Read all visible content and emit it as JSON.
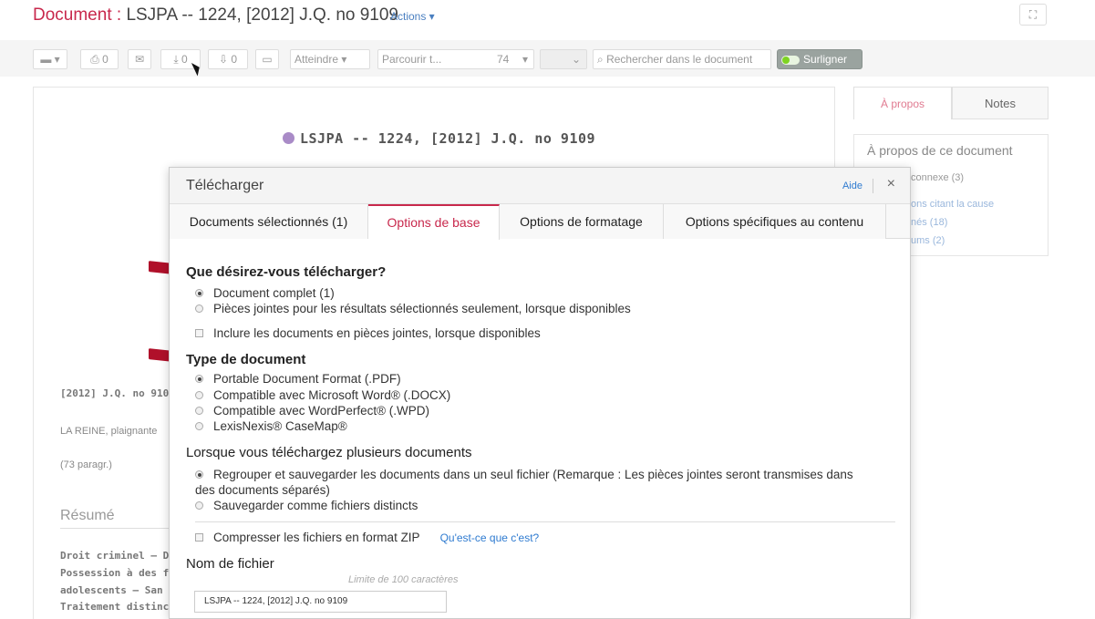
{
  "header": {
    "doc_label": "Document :",
    "doc_name": "LSJPA -- 1224, [2012] J.Q. no 9109",
    "actions_label": "Actions ▾",
    "expand_icon": "expand-icon"
  },
  "toolbar": {
    "print_count": "0",
    "download_count": "0",
    "save_count": "0",
    "goto_label": "Atteindre",
    "browse_label": "Parcourir t...",
    "browse_count": "74",
    "search_placeholder": "Rechercher dans le document",
    "highlight_label": "Surligner"
  },
  "document": {
    "heading": "LSJPA -- 1224, [2012] J.Q. no 9109",
    "citation": "[2012] J.Q. no 910",
    "parties": "LA REINE, plaignante",
    "paragraphs": "(73 paragr.)",
    "resume_title": "Résumé",
    "summary_lines": [
      "Droit criminel — Dé",
      "Possession à des fi",
      "adolescents — San",
      "Traitement distinct"
    ]
  },
  "sidebar": {
    "tab_about": "À propos",
    "tab_notes": "Notes",
    "about_title": "À propos de ce document",
    "lines": [
      "connexe (3)",
      "ons citant la cause",
      "nés (18)",
      "ums (2)"
    ]
  },
  "modal": {
    "title": "Télécharger",
    "help_label": "Aide",
    "close_label": "×",
    "tabs": [
      "Documents sélectionnés (1)",
      "Options de base",
      "Options de formatage",
      "Options spécifiques au contenu"
    ],
    "what_title": "Que désirez-vous télécharger?",
    "what_options": [
      "Document complet (1)",
      "Pièces jointes pour les résultats sélectionnés seulement, lorsque disponibles"
    ],
    "include_attachments": "Inclure les documents en pièces jointes, lorsque disponibles",
    "type_title": "Type de document",
    "type_options": [
      "Portable Document Format (.PDF)",
      "Compatible avec Microsoft Word® (.DOCX)",
      "Compatible avec WordPerfect® (.WPD)",
      "LexisNexis® CaseMap®"
    ],
    "multi_title": "Lorsque vous téléchargez plusieurs documents",
    "multi_options": [
      "Regrouper et sauvegarder les documents dans un seul fichier (Remarque : Les pièces jointes seront transmises dans",
      "des documents séparés)",
      "Sauvegarder comme fichiers distincts"
    ],
    "zip_label": "Compresser les fichiers en format ZIP",
    "zip_help": "Qu'est-ce que c'est?",
    "filename_title": "Nom de fichier",
    "filename_limit": "Limite de 100 caractères",
    "filename_value": "LSJPA -- 1224, [2012] J.Q. no 9109"
  },
  "colors": {
    "accent": "#c8284c",
    "link": "#2f7bd0",
    "arrow": "#b0102a"
  }
}
